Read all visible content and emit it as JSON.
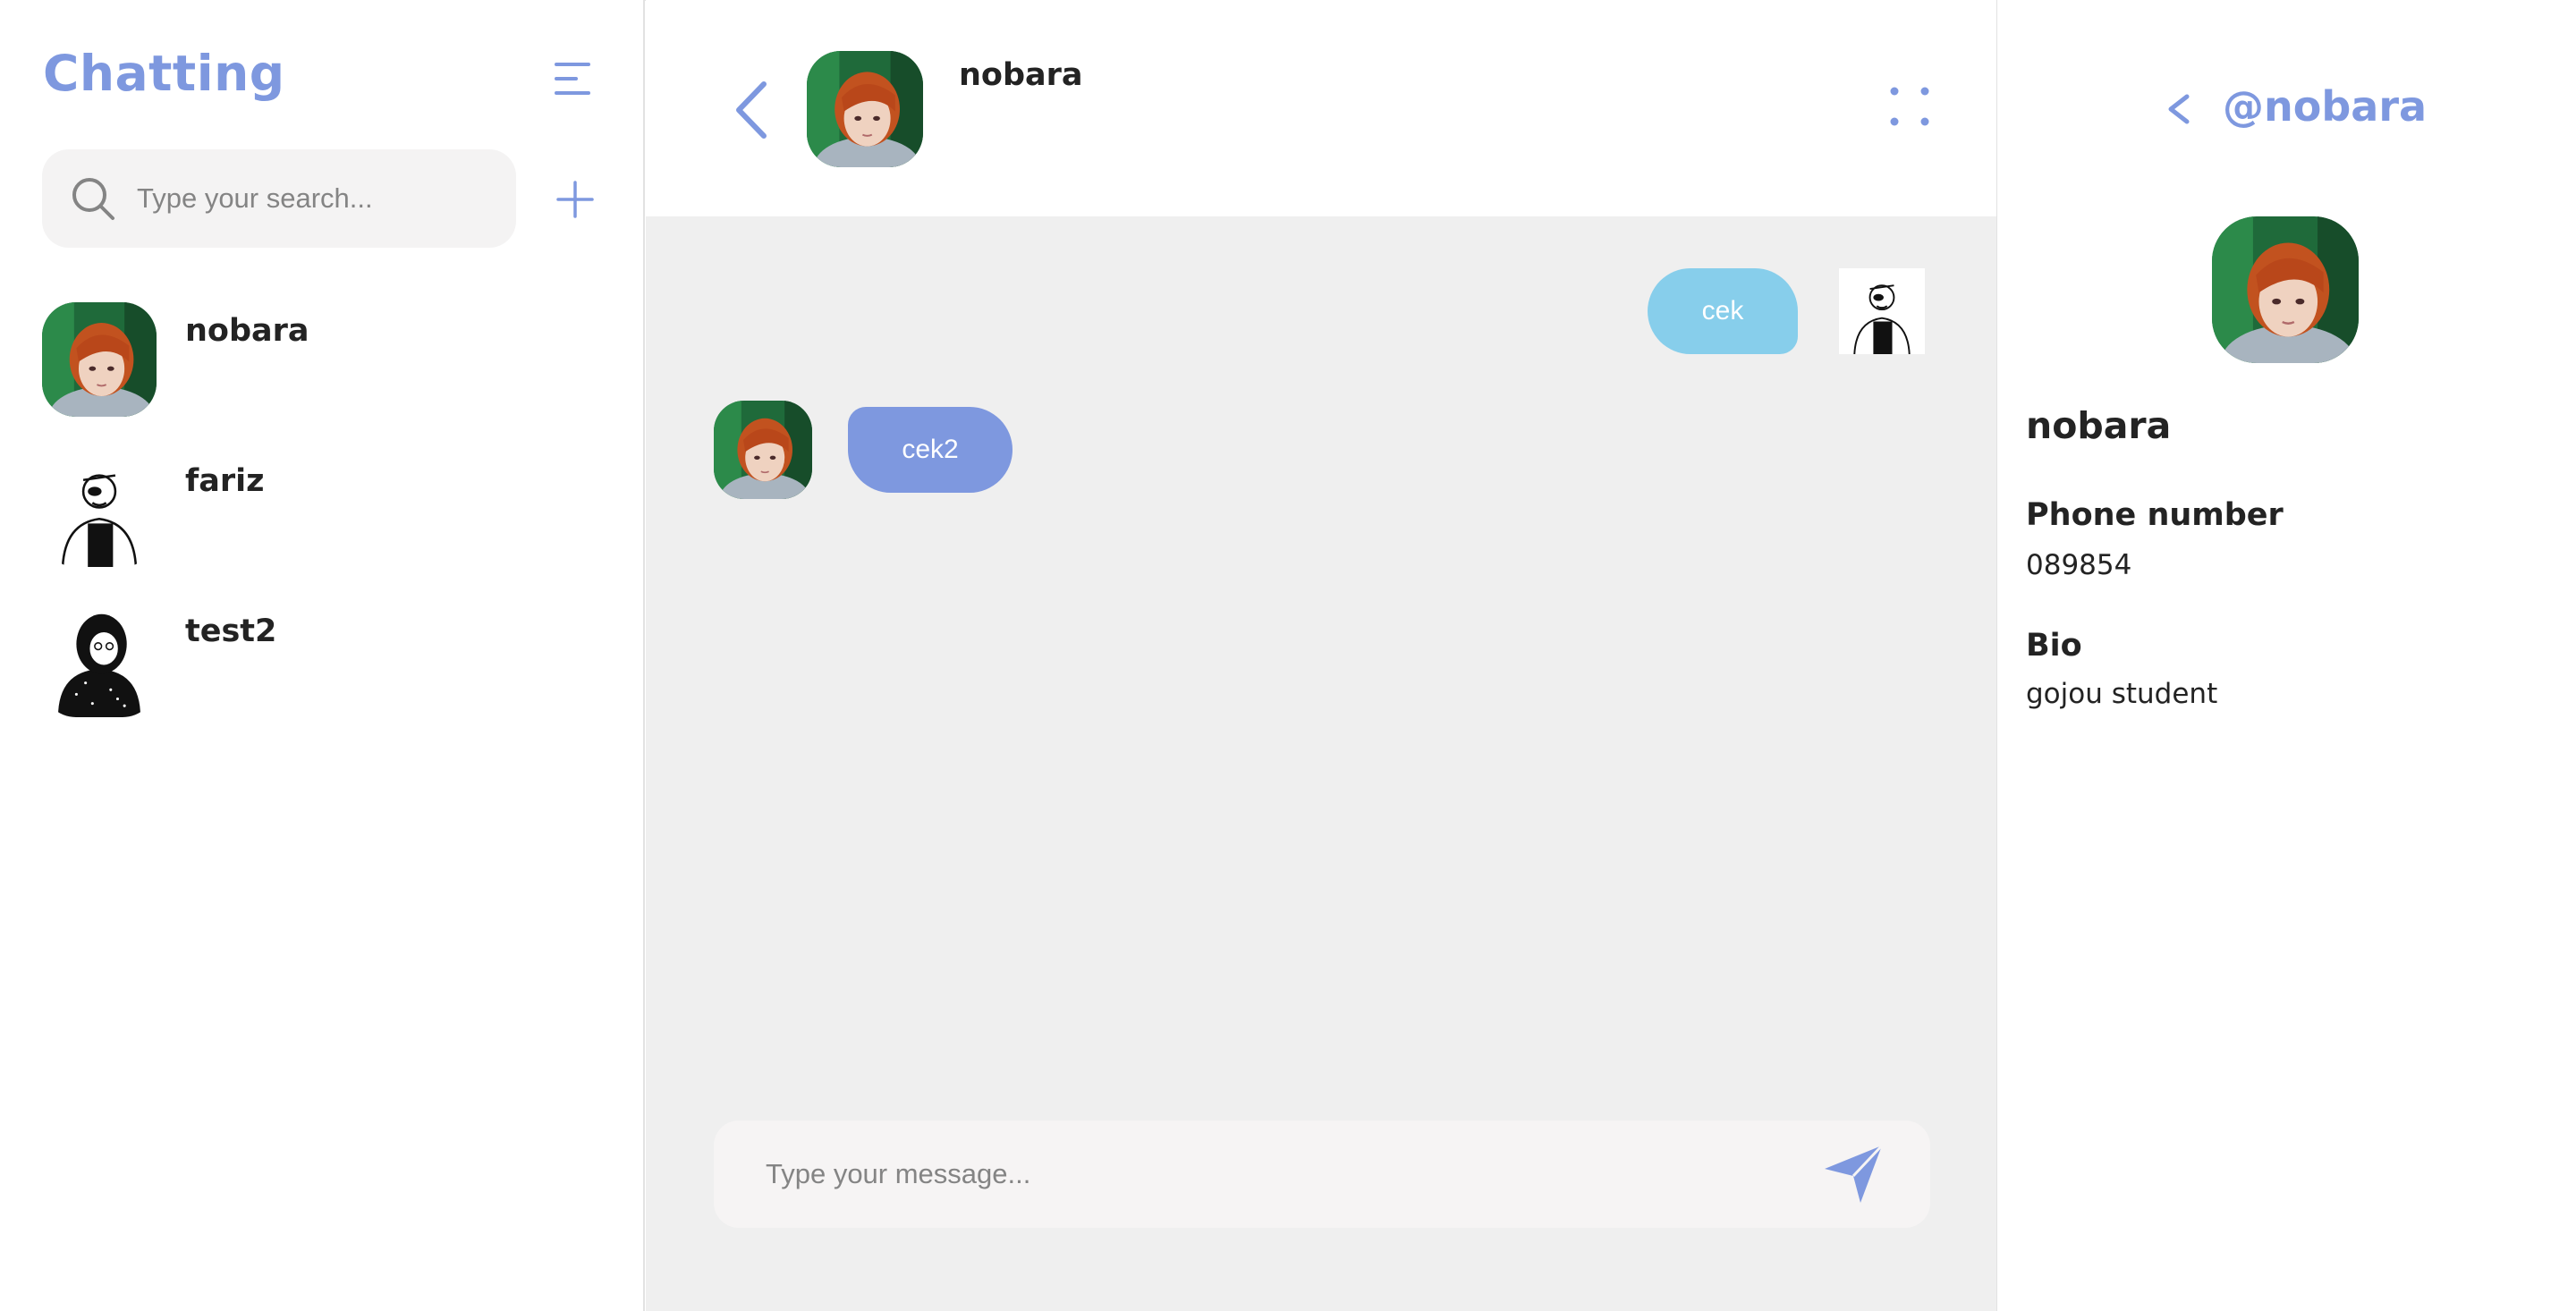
{
  "sidebar": {
    "title": "Chatting",
    "search_placeholder": "Type your search...",
    "contacts": [
      {
        "name": "nobara",
        "avatar": "nobara-avatar"
      },
      {
        "name": "fariz",
        "avatar": "fariz-avatar"
      },
      {
        "name": "test2",
        "avatar": "test2-avatar"
      }
    ]
  },
  "chat": {
    "header_name": "nobara",
    "messages": [
      {
        "direction": "outgoing",
        "text": "cek"
      },
      {
        "direction": "incoming",
        "text": "cek2"
      }
    ],
    "composer_placeholder": "Type your message..."
  },
  "profile": {
    "handle": "@nobara",
    "name": "nobara",
    "phone_label": "Phone number",
    "phone_value": "089854",
    "bio_label": "Bio",
    "bio_value": "gojou student"
  },
  "colors": {
    "accent": "#7e98df",
    "outgoing_bubble": "#87ceeb",
    "chat_background": "#efefef",
    "input_background": "#f4f3f3"
  },
  "icons": [
    "menu-icon",
    "search-icon",
    "plus-icon",
    "back-chevron-icon",
    "dots-grid-icon",
    "send-icon"
  ]
}
